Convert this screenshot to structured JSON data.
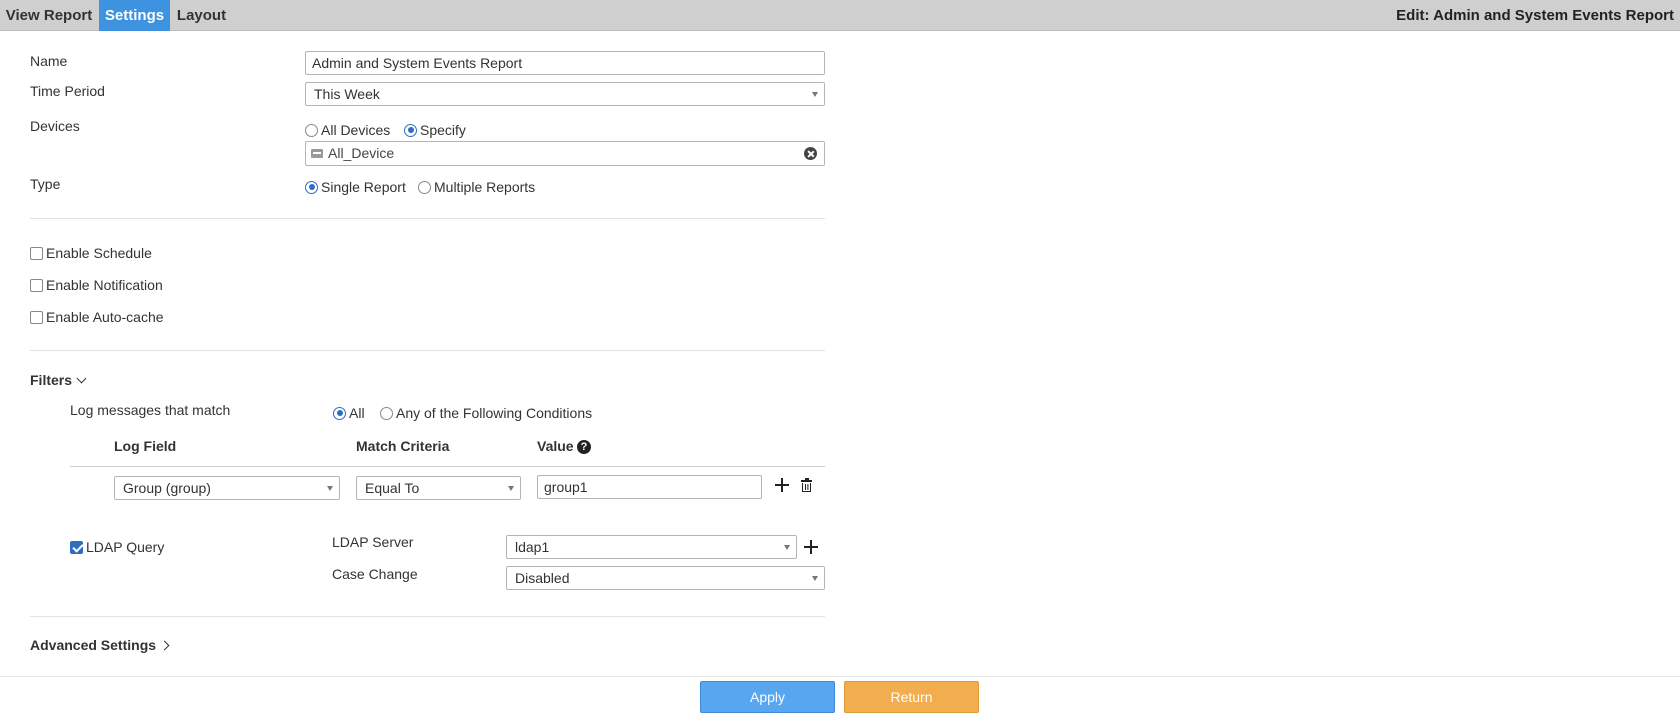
{
  "tabs": [
    {
      "label": "View Report"
    },
    {
      "label": "Settings"
    },
    {
      "label": "Layout"
    }
  ],
  "page_title": "Edit: Admin and System Events Report",
  "form": {
    "name_label": "Name",
    "name_value": "Admin and System Events Report",
    "time_period_label": "Time Period",
    "time_period_value": "This Week",
    "devices_label": "Devices",
    "devices_options": [
      "All Devices",
      "Specify"
    ],
    "devices_selected": "Specify",
    "device_tag": "All_Device",
    "type_label": "Type",
    "type_options": [
      "Single Report",
      "Multiple Reports"
    ],
    "type_selected": "Single Report"
  },
  "options": {
    "enable_schedule": "Enable Schedule",
    "enable_notification": "Enable Notification",
    "enable_autocache": "Enable Auto-cache"
  },
  "filters": {
    "title": "Filters",
    "match_label": "Log messages that match",
    "match_options": [
      "All",
      "Any of the Following Conditions"
    ],
    "match_selected": "All",
    "columns": {
      "log_field": "Log Field",
      "match_criteria": "Match Criteria",
      "value": "Value"
    },
    "help_glyph": "?",
    "rows": [
      {
        "log_field": "Group (group)",
        "match_criteria": "Equal To",
        "value": "group1"
      }
    ],
    "ldap_query_label": "LDAP Query",
    "ldap_server_label": "LDAP Server",
    "ldap_server_value": "ldap1",
    "case_change_label": "Case Change",
    "case_change_value": "Disabled"
  },
  "advanced": {
    "title": "Advanced Settings"
  },
  "buttons": {
    "apply": "Apply",
    "return": "Return"
  },
  "colors": {
    "accent": "#3d93e0",
    "apply": "#58a5f0",
    "return": "#f2ad4e"
  }
}
